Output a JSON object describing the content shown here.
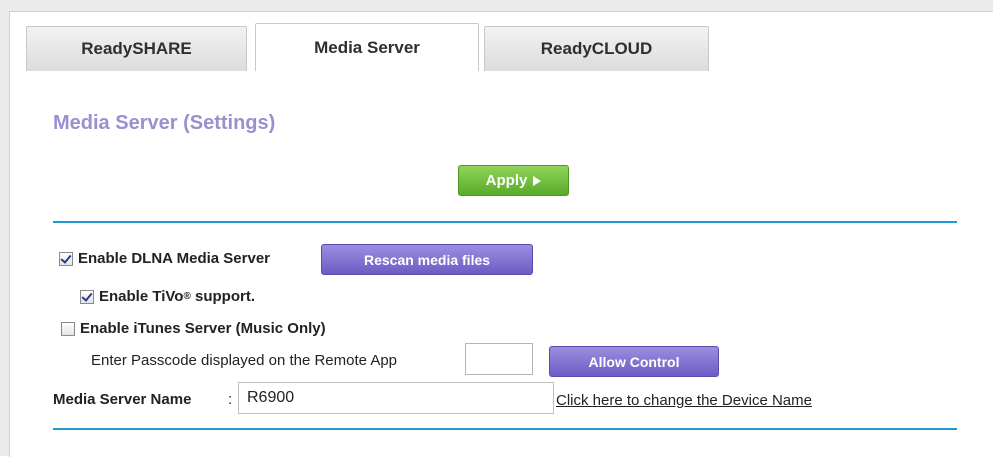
{
  "tabs": {
    "readyshare": "ReadySHARE",
    "mediaserver": "Media Server",
    "readycloud": "ReadyCLOUD",
    "active": "Media Server"
  },
  "page": {
    "title": "Media Server (Settings)",
    "apply_label": "Apply"
  },
  "dlna": {
    "label": "Enable DLNA Media Server",
    "checked": true,
    "rescan_label": "Rescan media files"
  },
  "tivo": {
    "label_prefix": "Enable TiVo",
    "registered_mark": "®",
    "label_suffix": " support.",
    "checked": true
  },
  "itunes": {
    "label": "Enable iTunes Server (Music Only)",
    "checked": false,
    "passcode_label": "Enter Passcode displayed on the Remote App",
    "passcode_value": "",
    "allow_label": "Allow Control"
  },
  "server_name": {
    "label": "Media Server Name",
    "colon": ":",
    "value": "R6900",
    "change_link": "Click here to change the Device Name"
  },
  "colors": {
    "title": "#9a90cf",
    "divider": "#1f98d3",
    "apply_green": "#5aaa2a",
    "button_purple": "#6c5cc4"
  },
  "icons": {
    "apply": "play-arrow-icon",
    "checkbox_on": "checkbox-checked-icon",
    "checkbox_off": "checkbox-unchecked-icon"
  }
}
